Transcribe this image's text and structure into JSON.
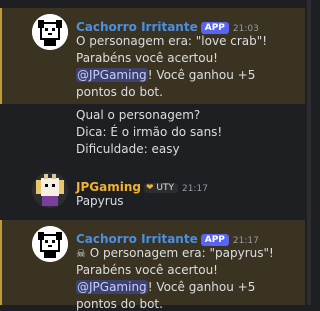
{
  "colors": {
    "background": "#1e1f22",
    "bot_name": "#4a90e2",
    "user_name": "#f0b232",
    "mention_bg": "#3c4270",
    "highlight_bg": "#3b3322",
    "app_badge": "#5865f2"
  },
  "messages": [
    {
      "author": "Cachorro Irritante",
      "badge": "APP",
      "time": "21:03",
      "lines": [
        "O personagem era: \"love crab\"!",
        "Parabéns você acertou!"
      ],
      "mention": "@JPGaming",
      "mention_rest": "! Você ganhou +5",
      "last_line": "pontos do bot."
    },
    {
      "lines": [
        "Qual o personagem?",
        "Dica: É o irmão do sans!",
        "Dificuldade: easy"
      ]
    },
    {
      "author": "JPGaming",
      "tag_icon": "heart-icon",
      "tag": "UTY",
      "time": "21:17",
      "text": "Papyrus"
    },
    {
      "author": "Cachorro Irritante",
      "badge": "APP",
      "time": "21:17",
      "emoji": "skeleton-emoji",
      "first_line": "O personagem era: \"papyrus\"!",
      "lines": [
        "Parabéns você acertou!"
      ],
      "mention": "@JPGaming",
      "mention_rest": "! Você ganhou +5",
      "last_line": "pontos do bot."
    }
  ]
}
